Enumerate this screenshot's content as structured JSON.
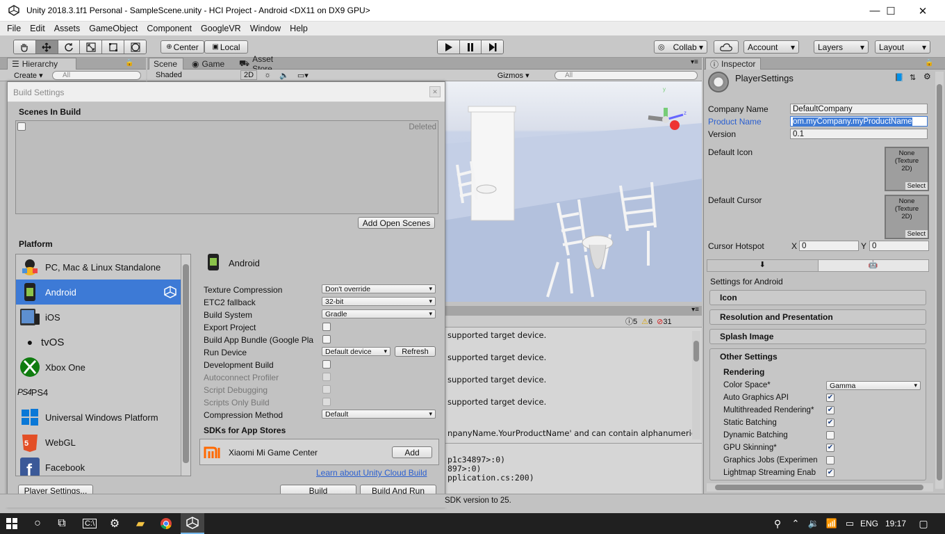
{
  "window": {
    "title": "Unity 2018.3.1f1 Personal - SampleScene.unity - HCI Project - Android <DX11 on DX9 GPU>",
    "minimize": "—",
    "maximize": "☐",
    "close": "✕"
  },
  "menu": [
    "File",
    "Edit",
    "Assets",
    "GameObject",
    "Component",
    "GoogleVR",
    "Window",
    "Help"
  ],
  "toolbar": {
    "pivot": "Center",
    "space": "Local",
    "collab": "Collab ▾",
    "account": "Account",
    "layers": "Layers",
    "layout": "Layout"
  },
  "hierarchy": {
    "tab": "Hierarchy",
    "create": "Create ▾",
    "search_placeholder": "All"
  },
  "scene": {
    "tabs": [
      "Scene",
      "Game",
      "Asset Store"
    ],
    "shading": "Shaded",
    "mode2d": "2D",
    "gizmos": "Gizmos ▾",
    "search_placeholder": "All"
  },
  "console": {
    "counts": {
      "info": "5",
      "warnings": "6",
      "errors": "31"
    },
    "lines": [
      "supported target device.",
      "supported target device.",
      "supported target device.",
      "supported target device.",
      "npanyName.YourProductName' and can contain alphanumeric",
      "p1c34897>:0)",
      "897>:0)",
      "pplication.cs:200)"
    ],
    "status": "SDK version to 25."
  },
  "build_settings": {
    "title": "Build Settings",
    "scenes_in_build": "Scenes In Build",
    "deleted": "Deleted",
    "add_open_scenes": "Add Open Scenes",
    "platform_heading": "Platform",
    "platforms": [
      {
        "label": "PC, Mac & Linux Standalone",
        "icon": "standalone-icon"
      },
      {
        "label": "Android",
        "icon": "android-icon",
        "selected": true
      },
      {
        "label": "iOS",
        "icon": "ios-icon"
      },
      {
        "label": "tvOS",
        "icon": "tvos-icon"
      },
      {
        "label": "Xbox One",
        "icon": "xbox-icon"
      },
      {
        "label": "PS4",
        "icon": "ps4-icon"
      },
      {
        "label": "Universal Windows Platform",
        "icon": "windows-icon"
      },
      {
        "label": "WebGL",
        "icon": "html5-icon"
      },
      {
        "label": "Facebook",
        "icon": "facebook-icon"
      }
    ],
    "selected_platform": "Android",
    "settings": {
      "texture_compression": {
        "label": "Texture Compression",
        "value": "Don't override"
      },
      "etc2_fallback": {
        "label": "ETC2 fallback",
        "value": "32-bit"
      },
      "build_system": {
        "label": "Build System",
        "value": "Gradle"
      },
      "export_project": "Export Project",
      "build_app_bundle": "Build App Bundle (Google Pla",
      "run_device": {
        "label": "Run Device",
        "value": "Default device",
        "refresh": "Refresh"
      },
      "development_build": "Development Build",
      "autoconnect_profiler": "Autoconnect Profiler",
      "script_debugging": "Script Debugging",
      "scripts_only_build": "Scripts Only Build",
      "compression_method": {
        "label": "Compression Method",
        "value": "Default"
      }
    },
    "sdks_heading": "SDKs for App Stores",
    "sdk_store": "Xiaomi Mi Game Center",
    "sdk_add": "Add",
    "cloud_link": "Learn about Unity Cloud Build",
    "player_settings": "Player Settings...",
    "build": "Build",
    "build_and_run": "Build And Run"
  },
  "inspector": {
    "tab": "Inspector",
    "header": "PlayerSettings",
    "company_name": {
      "label": "Company Name",
      "value": "DefaultCompany"
    },
    "product_name": {
      "label": "Product Name",
      "value": "om.myCompany.myProductName"
    },
    "version": {
      "label": "Version",
      "value": "0.1"
    },
    "default_icon": "Default Icon",
    "default_cursor": "Default Cursor",
    "texture_none": "None\n(Texture\n2D)",
    "select": "Select",
    "cursor_hotspot": {
      "label": "Cursor Hotspot",
      "x_label": "X",
      "x": "0",
      "y_label": "Y",
      "y": "0"
    },
    "settings_for": "Settings for Android",
    "sections": [
      "Icon",
      "Resolution and Presentation",
      "Splash Image",
      "Other Settings"
    ],
    "rendering": "Rendering",
    "color_space": {
      "label": "Color Space*",
      "value": "Gamma"
    },
    "options": [
      {
        "label": "Auto Graphics API",
        "checked": true
      },
      {
        "label": "Multithreaded Rendering*",
        "checked": true
      },
      {
        "label": "Static Batching",
        "checked": true
      },
      {
        "label": "Dynamic Batching",
        "checked": false
      },
      {
        "label": "GPU Skinning*",
        "checked": true
      },
      {
        "label": "Graphics Jobs (Experimen",
        "checked": false
      },
      {
        "label": "Lightmap Streaming Enab",
        "checked": true
      }
    ]
  },
  "taskbar": {
    "language": "ENG",
    "time": "19:17"
  },
  "colors": {
    "selection": "#3d7ad6",
    "link": "#2a5fd0",
    "error": "#d42020"
  }
}
